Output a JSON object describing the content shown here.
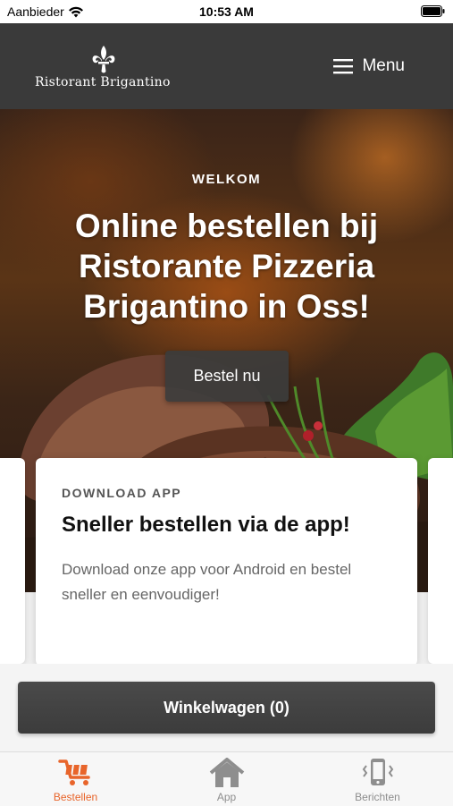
{
  "status_bar": {
    "carrier": "Aanbieder",
    "time": "10:53 AM"
  },
  "header": {
    "logo_text": "Ristorant   Brigantino",
    "menu_label": "Menu",
    "menu_icon": "hamburger-icon",
    "logo_icon": "fleur-de-lis-icon"
  },
  "hero": {
    "eyebrow": "WELKOM",
    "headline": "Online bestellen bij Ristorante Pizzeria Brigantino in Oss!",
    "cta_label": "Bestel nu"
  },
  "promo_card": {
    "eyebrow": "DOWNLOAD APP",
    "title": "Sneller bestellen via de app!",
    "body": "Download onze app voor Android en bestel sneller en eenvoudiger!"
  },
  "cart": {
    "label": "Winkelwagen (0)"
  },
  "tabs": [
    {
      "label": "Bestellen",
      "icon": "cart-icon",
      "active": true
    },
    {
      "label": "App",
      "icon": "home-icon",
      "active": false
    },
    {
      "label": "Berichten",
      "icon": "phone-vibrate-icon",
      "active": false
    }
  ],
  "colors": {
    "accent": "#e8652b",
    "header_bg": "#3a3a3a",
    "button_bg": "#3c3c3c"
  }
}
